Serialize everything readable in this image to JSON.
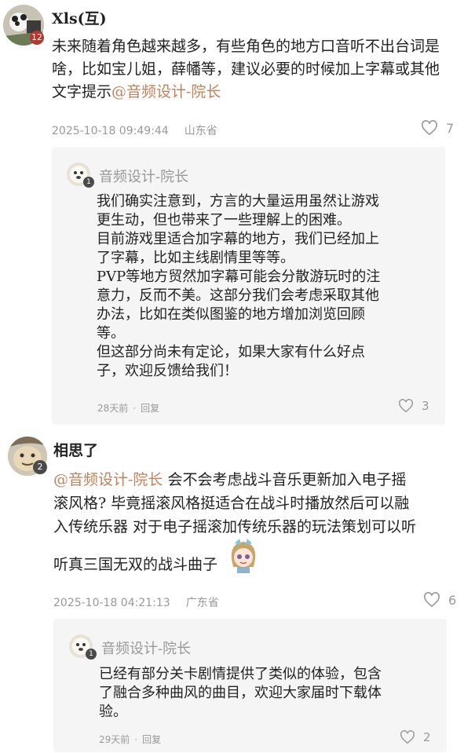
{
  "comments": [
    {
      "user": "Xls(互)",
      "level": "12",
      "text": "未来随着角色越来越多，有些角色的地方口音听不出台词是啥，比如宝儿姐，薛幡等，建议必要的时候加上字幕或其他文字提示",
      "mention": "@音频设计-院长",
      "time": "2025-10-18 09:49:44",
      "location": "山东省",
      "likes": "7",
      "reply": {
        "user": "音频设计-院长",
        "level": "1",
        "lines": [
          "我们确实注意到，方言的大量运用虽然让游戏",
          "更生动，但也带来了一些理解上的困难。",
          "目前游戏里适合加字幕的地方，我们已经加上",
          "了字幕，比如主线剧情里等等。",
          "PVP等地方贸然加字幕可能会分散游玩时的注",
          "意力，反而不美。这部分我们会考虑采取其他",
          "办法，比如在类似图鉴的地方增加浏览回顾",
          "等。",
          "但这部分尚未有定论，如果大家有什么好点",
          "子，欢迎反馈给我们！"
        ],
        "time": "28天前",
        "action": "回复",
        "likes": "3"
      }
    },
    {
      "user": "相思了",
      "level": "2",
      "mention": "@音频设计-院长",
      "text_line1": " 会不会考虑战斗音乐更新加入电子摇",
      "text_line2": "滚风格? 毕竟摇滚风格挺适合在战斗时播放然后可以融",
      "text_line3": "入传统乐器 对于电子摇滚加传统乐器的玩法策划可以听",
      "text_line4": "听真三国无双的战斗曲子",
      "time": "2025-10-18 04:21:13",
      "location": "广东省",
      "likes": "6",
      "reply": {
        "user": "音频设计-院长",
        "level": "1",
        "lines": [
          "已经有部分关卡剧情提供了类似的体验，包含",
          "了融合多种曲风的曲目，欢迎大家届时下载体",
          "验。"
        ],
        "time": "29天前",
        "action": "回复",
        "likes": "2"
      }
    }
  ],
  "icons": {
    "like": "heart-outline-icon",
    "sticker": "anime-girl-sticker"
  },
  "colors": {
    "mention": "#c0805a",
    "meta": "#999999",
    "reply_bg": "#f5f5f5"
  }
}
